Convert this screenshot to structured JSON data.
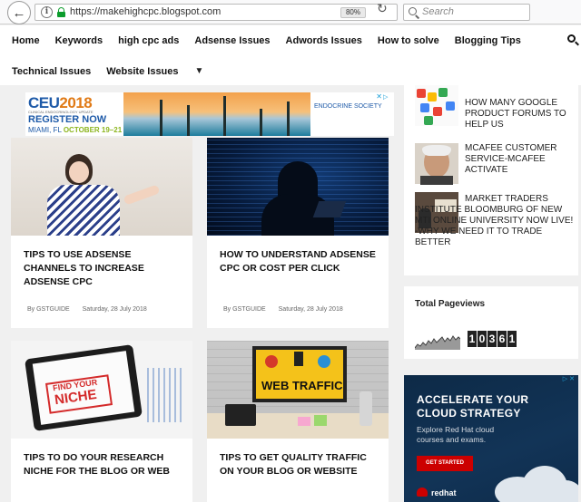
{
  "browser": {
    "url": "https://makehighcpc.blogspot.com",
    "zoom": "80%",
    "search_placeholder": "Search"
  },
  "nav": {
    "row1": [
      "Home",
      "Keywords",
      "high cpc ads",
      "Adsense Issues",
      "Adwords Issues",
      "How to solve",
      "Blogging Tips"
    ],
    "row2": [
      "Technical Issues",
      "Website Issues"
    ],
    "more_caret": "▼"
  },
  "top_ad": {
    "brand": "CEU",
    "year": "2018",
    "subtitle": "CLINICAL ENDOCRINOLOGY UPDATE",
    "cta": "REGISTER NOW",
    "location": "MIAMI, FL",
    "dates": "OCTOBER 19–21",
    "logo_text": "ENDOCRINE SOCIETY"
  },
  "posts": [
    {
      "title": "TIPS TO USE ADSENSE CHANNELS TO INCREASE ADSENSE CPC",
      "author": "By GSTGUIDE",
      "date": "Saturday, 28 July 2018"
    },
    {
      "title": "HOW TO UNDERSTAND ADSENSE CPC OR COST PER CLICK",
      "author": "By GSTGUIDE",
      "date": "Saturday, 28 July 2018"
    },
    {
      "title": "TIPS TO DO YOUR RESEARCH NICHE FOR THE BLOG OR WEB",
      "thumb_text_1": "FIND YOUR",
      "thumb_text_2": "NICHE"
    },
    {
      "title": "TIPS TO GET QUALITY TRAFFIC ON YOUR BLOG OR WEBSITE",
      "thumb_text": "WEB TRAFFIC"
    }
  ],
  "sidebar": {
    "popular": [
      {
        "title": "HOW MANY GOOGLE PRODUCT FORUMS TO HELP US"
      },
      {
        "title": "MCAFEE CUSTOMER SERVICE-MCAFEE ACTIVATE"
      },
      {
        "title": "MARKET TRADERS INSTITUTE BLOOMBURG OF NEW MTI ONLINE UNIVERSITY NOW LIVE! -WHY WE NEED IT TO TRADE BETTER"
      }
    ],
    "pageviews_title": "Total Pageviews",
    "pageviews_digits": [
      "1",
      "0",
      "3",
      "6",
      "1"
    ],
    "ad": {
      "headline": "ACCELERATE YOUR CLOUD STRATEGY",
      "body": "Explore Red Hat cloud courses and exams.",
      "button": "GET STARTED",
      "logo": "redhat"
    }
  },
  "colors": {
    "accent_blue": "#1e5aa8",
    "ad_red": "#cc0000",
    "rh_navy": "#0d2a47"
  }
}
